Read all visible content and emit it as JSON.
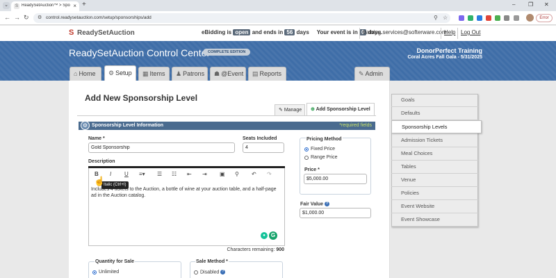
{
  "browser": {
    "tab_title": "ReadySetAuction™ > Sponsor",
    "url": "control.readysetauction.com/setup/sponsorships/add",
    "error_label": "Error"
  },
  "site": {
    "logo": "ReadySetAuction",
    "bidding_prefix": "eBidding is",
    "bidding_state": "open",
    "bidding_mid": "and ends in",
    "bidding_days": "56",
    "days_word": "days",
    "event_prefix": "Your event is in",
    "event_days": "0",
    "event_suffix": "days.",
    "email": "training.services@softerware.com",
    "help": "Help",
    "logout": "Log Out"
  },
  "banner": {
    "title": "ReadySetAuction Control Center",
    "edition": "COMPLETE EDITION",
    "org": "DonorPerfect Training",
    "event": "Coral Acres Fall Gala - 5/31/2025"
  },
  "nav": {
    "home": "Home",
    "setup": "Setup",
    "items": "Items",
    "patrons": "Patrons",
    "event": "@Event",
    "reports": "Reports",
    "admin": "Admin"
  },
  "page": {
    "title": "Add New Sponsorship Level",
    "tab_manage": "Manage",
    "tab_add": "Add Sponsorship Level",
    "section_title": "Sponsorship Level Information",
    "required_note": "*required fields"
  },
  "form": {
    "name_label": "Name *",
    "name_value": "Gold Sponsorship",
    "seats_label": "Seats Included",
    "seats_value": "4",
    "pricing_label": "Pricing Method",
    "pricing_fixed": "Fixed Price",
    "pricing_range": "Range Price",
    "price_label": "Price *",
    "price_value": "$5,000.00",
    "description_label": "Description",
    "tooltip": "Italic (Ctrl+I)",
    "description_text": "Includes 4 tickets to the Auction, a bottle of wine at your auction table, and a half-page ad in the Auction catalog.",
    "chars_label": "Characters remaining:",
    "chars_value": "900",
    "fair_value_label": "Fair Value",
    "fair_value_value": "$1,000.00",
    "quantity_label": "Quantity for Sale",
    "quantity_option": "Unlimited",
    "sale_method_label": "Sale Method *",
    "sale_method_option": "Disabled"
  },
  "toolbar": {
    "bold": "B",
    "italic": "I",
    "underline": "U",
    "align": "≡▾",
    "ul": "☰",
    "ol": "☷",
    "outdent": "⇤",
    "indent": "⇥",
    "image": "▣",
    "link": "⚲",
    "undo": "↶",
    "redo": "↷"
  },
  "side_menu": [
    "Goals",
    "Defaults",
    "Sponsorship Levels",
    "Admission Tickets",
    "Meal Choices",
    "Tables",
    "Venue",
    "Policies",
    "Event Website",
    "Event Showcase"
  ]
}
